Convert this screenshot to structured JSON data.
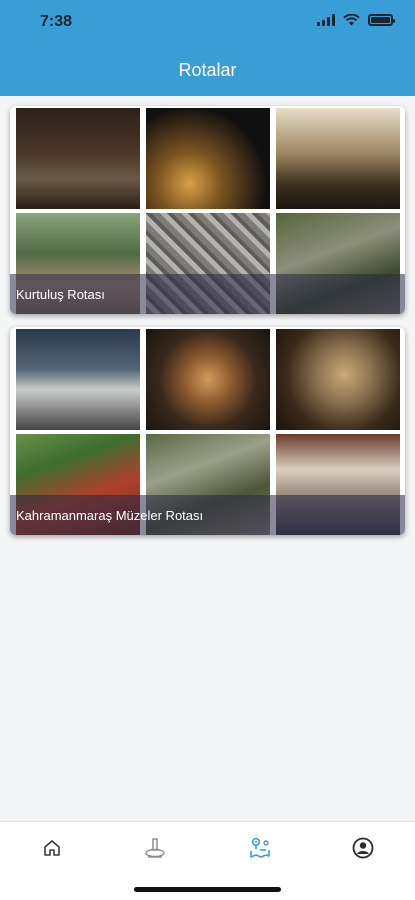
{
  "status_bar": {
    "time": "7:38"
  },
  "header": {
    "title": "Rotalar"
  },
  "routes": [
    {
      "title": "Kurtuluş Rotası"
    },
    {
      "title": "Kahramanmaraş Müzeler Rotası"
    }
  ],
  "tab_bar": {
    "items": [
      "home-icon",
      "monument-icon",
      "route-map-icon",
      "profile-icon"
    ],
    "active": "route-map-icon"
  },
  "colors": {
    "header": "#3a9ed6",
    "active_tab": "#3a9ed6",
    "inactive_tab": "#3a3a3a"
  }
}
